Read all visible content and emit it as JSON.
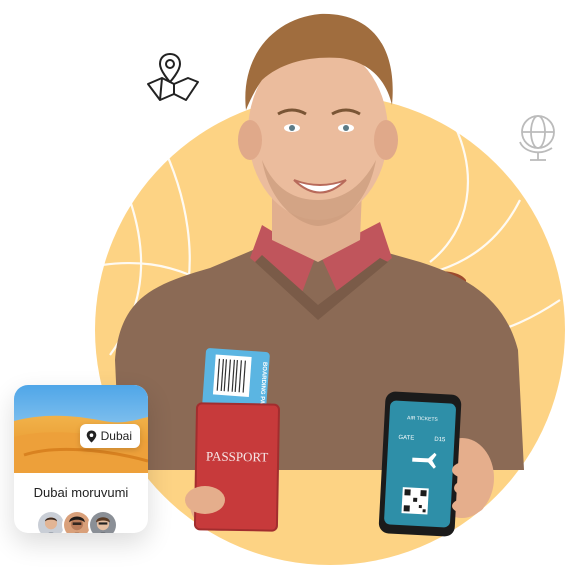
{
  "illustration": {
    "passport_text": "PASSPORT",
    "boarding_pass_text": "BOARDING PASS",
    "phone_header": "AIR TICKETS",
    "phone_gate_label": "GATE",
    "phone_gate_value": "D15"
  },
  "icons": {
    "map": "map-pin-icon",
    "globe": "globe-icon",
    "location": "location-pin-icon"
  },
  "tour_card": {
    "location": "Dubai",
    "title": "Dubai moruvumi",
    "avatars": [
      "avatar-1",
      "avatar-2",
      "avatar-3"
    ]
  },
  "colors": {
    "accent_circle": "#FDD384",
    "passport_red": "#C73A3B",
    "phone_screen": "#2E8FA8"
  }
}
